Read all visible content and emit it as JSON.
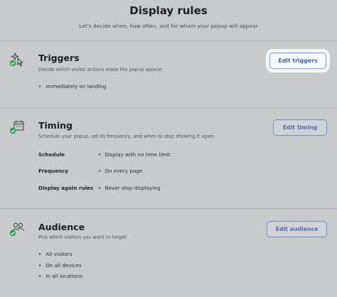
{
  "header": {
    "title": "Display rules",
    "subtitle": "Let's decide when, how often, and for whom your popup will appear"
  },
  "triggers": {
    "title": "Triggers",
    "description": "Decide which visitor actions make the popup appear",
    "button_label": "Edit triggers",
    "icon": "sparkle-pointer-icon",
    "items": [
      "Immediately on landing"
    ]
  },
  "timing": {
    "title": "Timing",
    "description": "Schedule your popup, set its frequency, and when to stop showing it again",
    "button_label": "Edit timing",
    "icon": "calendar-icon",
    "rules": [
      {
        "label": "Schedule",
        "value": "Display with no time limit"
      },
      {
        "label": "Frequency",
        "value": "On every page"
      },
      {
        "label": "Display again rules",
        "value": "Never stop displaying"
      }
    ]
  },
  "audience": {
    "title": "Audience",
    "description": "Pick which visitors you want to target",
    "button_label": "Edit audience",
    "icon": "users-icon",
    "items": [
      "All visitors",
      "On all devices",
      "In all locations"
    ]
  },
  "colors": {
    "background": "#c9cacc",
    "accent": "#4d6fa9",
    "check": "#2e9e59"
  }
}
